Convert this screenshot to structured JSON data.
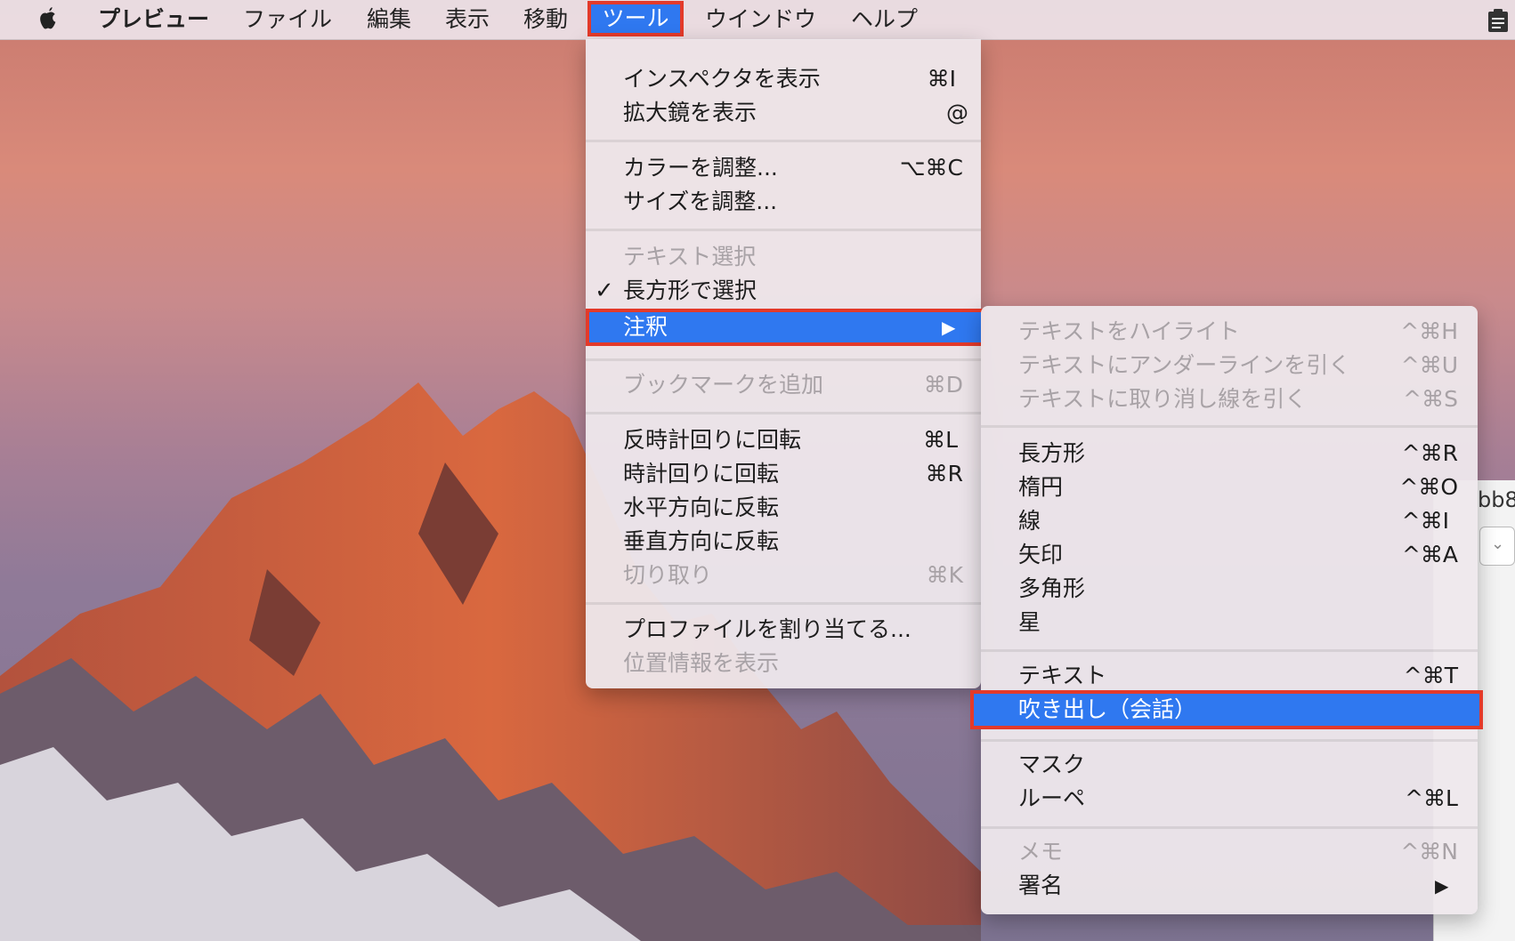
{
  "menubar": {
    "app_name": "プレビュー",
    "file": "ファイル",
    "edit": "編集",
    "view": "表示",
    "go": "移動",
    "tools": "ツール",
    "window": "ウインドウ",
    "help": "ヘルプ"
  },
  "tools_menu": {
    "show_inspector": {
      "label": "インスペクタを表示",
      "shortcut": "⌘I"
    },
    "show_magnifier": {
      "label": "拡大鏡を表示",
      "shortcut": "@"
    },
    "adjust_color": {
      "label": "カラーを調整...",
      "shortcut": "⌥⌘C"
    },
    "adjust_size": {
      "label": "サイズを調整..."
    },
    "text_selection": {
      "label": "テキスト選択"
    },
    "rect_selection": {
      "label": "長方形で選択",
      "check": "✓"
    },
    "annotate": {
      "label": "注釈",
      "arrow": "▶"
    },
    "add_bookmark": {
      "label": "ブックマークを追加",
      "shortcut": "⌘D"
    },
    "rotate_left": {
      "label": "反時計回りに回転",
      "shortcut": "⌘L"
    },
    "rotate_right": {
      "label": "時計回りに回転",
      "shortcut": "⌘R"
    },
    "flip_horizontal": {
      "label": "水平方向に反転"
    },
    "flip_vertical": {
      "label": "垂直方向に反転"
    },
    "crop": {
      "label": "切り取り",
      "shortcut": "⌘K"
    },
    "assign_profile": {
      "label": "プロファイルを割り当てる..."
    },
    "show_location": {
      "label": "位置情報を表示"
    }
  },
  "annotate_menu": {
    "highlight": {
      "label": "テキストをハイライト",
      "shortcut": "^⌘H"
    },
    "underline": {
      "label": "テキストにアンダーラインを引く",
      "shortcut": "^⌘U"
    },
    "strikethrough": {
      "label": "テキストに取り消し線を引く",
      "shortcut": "^⌘S"
    },
    "rectangle": {
      "label": "長方形",
      "shortcut": "^⌘R"
    },
    "oval": {
      "label": "楕円",
      "shortcut": "^⌘O"
    },
    "line": {
      "label": "線",
      "shortcut": "^⌘I"
    },
    "arrow": {
      "label": "矢印",
      "shortcut": "^⌘A"
    },
    "polygon": {
      "label": "多角形"
    },
    "star": {
      "label": "星"
    },
    "text": {
      "label": "テキスト",
      "shortcut": "^⌘T"
    },
    "speech_bubble": {
      "label": "吹き出し（会話）"
    },
    "mask": {
      "label": "マスク"
    },
    "loupe": {
      "label": "ルーペ",
      "shortcut": "^⌘L"
    },
    "note": {
      "label": "メモ",
      "shortcut": "^⌘N"
    },
    "signature": {
      "label": "署名",
      "arrow": "▶"
    }
  },
  "background_window": {
    "title_fragment": "bb8",
    "select_chevron": "⌄"
  },
  "colors": {
    "highlight": "#2f78f0",
    "callout_border": "#e33a2a"
  }
}
